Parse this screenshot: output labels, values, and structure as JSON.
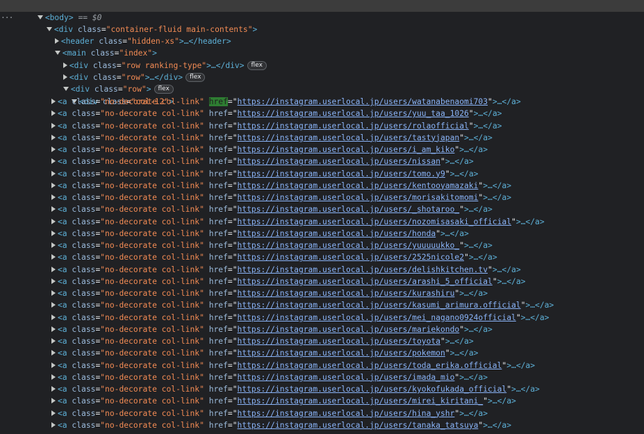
{
  "header": {
    "dots": "···",
    "body_tag": "<body>",
    "eq_label": "== $0"
  },
  "tree": {
    "container": {
      "open": "<div",
      "attr": "class",
      "value": "\"container-fluid main-contents\"",
      "close": ">"
    },
    "header_el": {
      "open": "<header",
      "attr": "class",
      "value": "\"hidden-xs\"",
      "rest": ">…</header>"
    },
    "main_el": {
      "open": "<main",
      "attr": "class",
      "value": "\"index\"",
      "close": ">"
    },
    "row_ranking": {
      "open": "<div",
      "attr": "class",
      "value": "\"row ranking-type\"",
      "rest": ">…</div>",
      "badge": "flex"
    },
    "row_2": {
      "open": "<div",
      "attr": "class",
      "value": "\"row\"",
      "rest": ">…</div>",
      "badge": "flex"
    },
    "row_3": {
      "open": "<div",
      "attr": "class",
      "value": "\"row\"",
      "rest": ">",
      "badge": "flex"
    },
    "col12": {
      "open": "<div",
      "attr": "class",
      "value": "\"col-12\"",
      "close": ">"
    }
  },
  "anchor": {
    "open": "<a",
    "class_attr": "class",
    "class_value": "\"no-decorate col-link\"",
    "href_attr": "href",
    "tail": ">…</a>"
  },
  "links": [
    "https://instagram.userlocal.jp/users/watanabenaomi703",
    "https://instagram.userlocal.jp/users/yuu_taa_1026",
    "https://instagram.userlocal.jp/users/rolaofficial",
    "https://instagram.userlocal.jp/users/tastyjapan",
    "https://instagram.userlocal.jp/users/i_am_kiko",
    "https://instagram.userlocal.jp/users/nissan",
    "https://instagram.userlocal.jp/users/tomo.y9",
    "https://instagram.userlocal.jp/users/kentooyamazaki",
    "https://instagram.userlocal.jp/users/morisakitomomi",
    "https://instagram.userlocal.jp/users/_shotaroo_",
    "https://instagram.userlocal.jp/users/nozomisasaki_official",
    "https://instagram.userlocal.jp/users/honda",
    "https://instagram.userlocal.jp/users/yuuuuukko_",
    "https://instagram.userlocal.jp/users/2525nicole2",
    "https://instagram.userlocal.jp/users/delishkitchen.tv",
    "https://instagram.userlocal.jp/users/arashi_5_official",
    "https://instagram.userlocal.jp/users/kurashiru",
    "https://instagram.userlocal.jp/users/kasumi_arimura.official",
    "https://instagram.userlocal.jp/users/mei_nagano0924official",
    "https://instagram.userlocal.jp/users/mariekondo",
    "https://instagram.userlocal.jp/users/toyota",
    "https://instagram.userlocal.jp/users/pokemon",
    "https://instagram.userlocal.jp/users/toda_erika.official",
    "https://instagram.userlocal.jp/users/imada_mio",
    "https://instagram.userlocal.jp/users/kyokofukada_official",
    "https://instagram.userlocal.jp/users/mirei_kiritani_",
    "https://instagram.userlocal.jp/users/hina_yshr",
    "https://instagram.userlocal.jp/users/tanaka_tatsuya"
  ],
  "colors": {
    "background": "#202124",
    "tag": "#5db0d7",
    "attr_value": "#f28b54",
    "url": "#8ab4f8",
    "highlight": "#2e7d32"
  },
  "icons": {
    "expanded": "triangle-down-icon",
    "collapsed": "triangle-right-icon"
  }
}
